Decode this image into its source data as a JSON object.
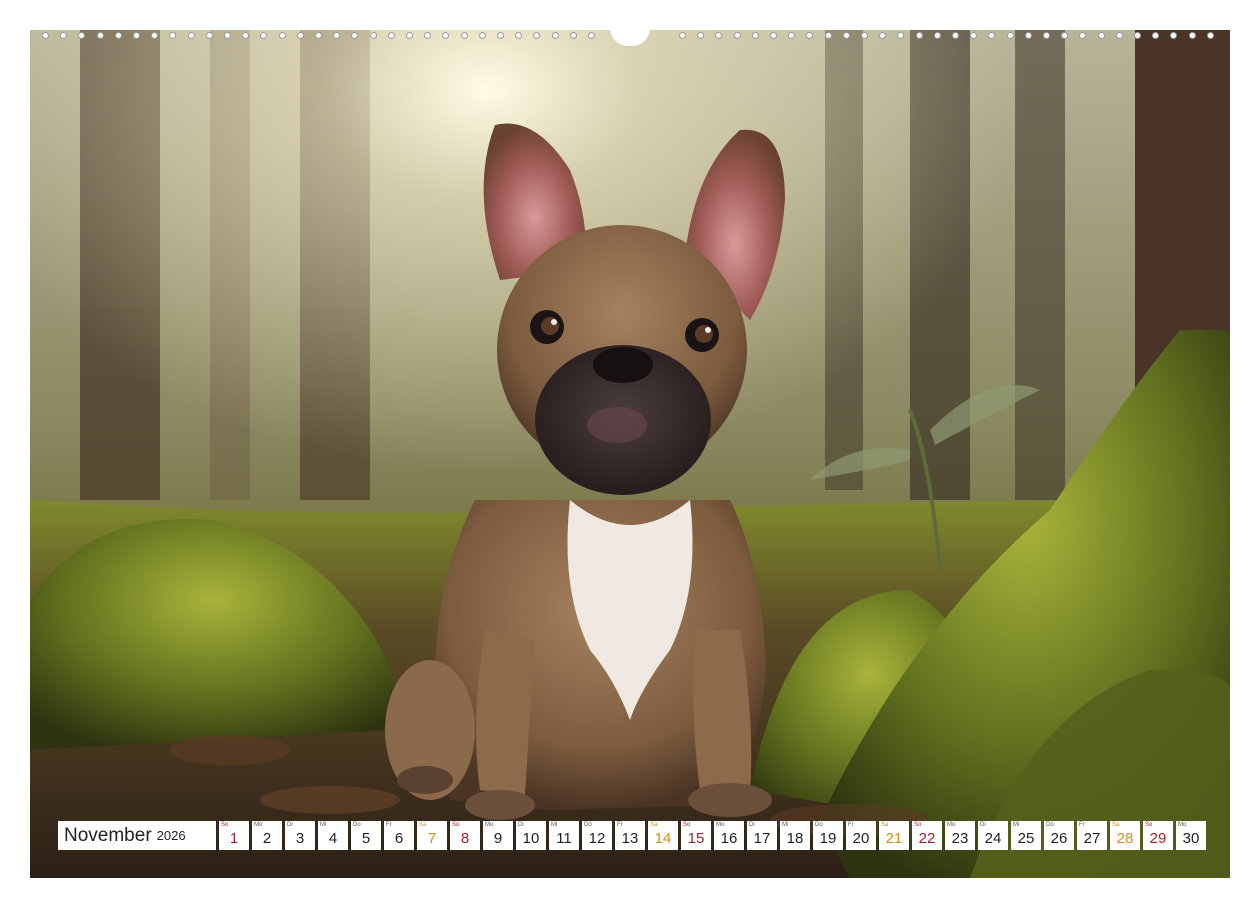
{
  "calendar": {
    "month": "November",
    "year": "2026",
    "days": [
      {
        "wd": "So",
        "d": "1",
        "type": "sun"
      },
      {
        "wd": "Mo",
        "d": "2",
        "type": "wk"
      },
      {
        "wd": "Di",
        "d": "3",
        "type": "wk"
      },
      {
        "wd": "Mi",
        "d": "4",
        "type": "wk"
      },
      {
        "wd": "Do",
        "d": "5",
        "type": "wk"
      },
      {
        "wd": "Fr",
        "d": "6",
        "type": "wk"
      },
      {
        "wd": "Sa",
        "d": "7",
        "type": "sat"
      },
      {
        "wd": "So",
        "d": "8",
        "type": "sun"
      },
      {
        "wd": "Mo",
        "d": "9",
        "type": "wk"
      },
      {
        "wd": "Di",
        "d": "10",
        "type": "wk"
      },
      {
        "wd": "Mi",
        "d": "11",
        "type": "wk"
      },
      {
        "wd": "Do",
        "d": "12",
        "type": "wk"
      },
      {
        "wd": "Fr",
        "d": "13",
        "type": "wk"
      },
      {
        "wd": "Sa",
        "d": "14",
        "type": "sat"
      },
      {
        "wd": "So",
        "d": "15",
        "type": "sun"
      },
      {
        "wd": "Mo",
        "d": "16",
        "type": "wk"
      },
      {
        "wd": "Di",
        "d": "17",
        "type": "wk"
      },
      {
        "wd": "Mi",
        "d": "18",
        "type": "wk"
      },
      {
        "wd": "Do",
        "d": "19",
        "type": "wk"
      },
      {
        "wd": "Fr",
        "d": "20",
        "type": "wk"
      },
      {
        "wd": "Sa",
        "d": "21",
        "type": "sat"
      },
      {
        "wd": "So",
        "d": "22",
        "type": "sun"
      },
      {
        "wd": "Mo",
        "d": "23",
        "type": "wk"
      },
      {
        "wd": "Di",
        "d": "24",
        "type": "wk"
      },
      {
        "wd": "Mi",
        "d": "25",
        "type": "wk"
      },
      {
        "wd": "Do",
        "d": "26",
        "type": "wk"
      },
      {
        "wd": "Fr",
        "d": "27",
        "type": "wk"
      },
      {
        "wd": "Sa",
        "d": "28",
        "type": "sat"
      },
      {
        "wd": "So",
        "d": "29",
        "type": "sun"
      },
      {
        "wd": "Mo",
        "d": "30",
        "type": "wk"
      }
    ]
  },
  "colors": {
    "saturday": "#d08f1f",
    "sunday": "#a3202a",
    "weekday": "#222222"
  }
}
